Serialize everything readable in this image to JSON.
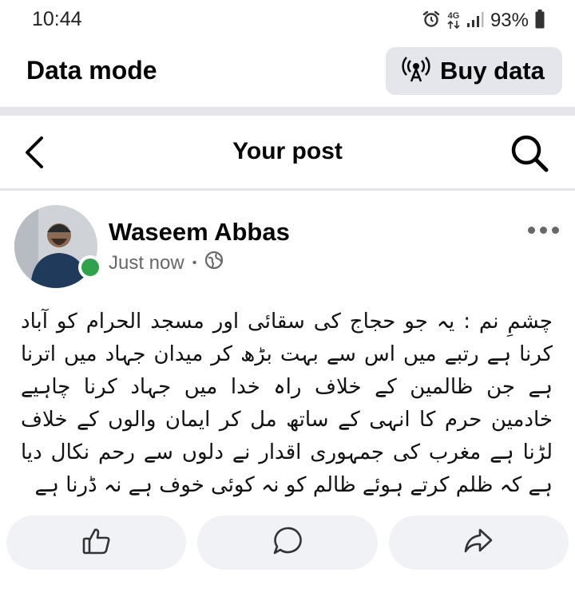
{
  "status_bar": {
    "time": "10:44",
    "network": "4G",
    "battery": "93%",
    "icons": [
      "alarm-icon",
      "network-4g-icon",
      "signal-icon",
      "battery-icon"
    ]
  },
  "data_bar": {
    "title": "Data mode",
    "buy_label": "Buy data",
    "buy_icon": "broadcast-icon"
  },
  "header": {
    "title": "Your post",
    "back_icon": "back-arrow-icon",
    "search_icon": "search-icon"
  },
  "post": {
    "author": "Waseem Abbas",
    "time": "Just now",
    "separator": "•",
    "audience_icon": "globe-icon",
    "online_color": "#31a24c",
    "text": "چشمِ نم : یہ جو حجاج کی سقائی اور مسجد الحرام کو آباد کرنا ہے رتبے میں اس سے بہت بڑھ کر میدان جہاد میں اترنا ہے جن ظالمین کے خلاف راہ خدا میں جہاد کرنا چاہیے خادمین حرم کا انہی کے ساتھ مل کر ایمان والوں کے خلاف لڑنا ہے مغرب کی جمہوری اقدار نے دلوں سے رحم نکال دیا ہے کہ ظلم کرتے ہوئے ظالم کو نہ کوئی خوف ہے نہ ڈرنا ہے"
  },
  "actions": {
    "like_icon": "like-icon",
    "comment_icon": "comment-icon",
    "share_icon": "share-icon"
  },
  "colors": {
    "divider": "#e4e6eb",
    "button_bg": "#f0f2f5",
    "secondary_text": "#65676b"
  }
}
